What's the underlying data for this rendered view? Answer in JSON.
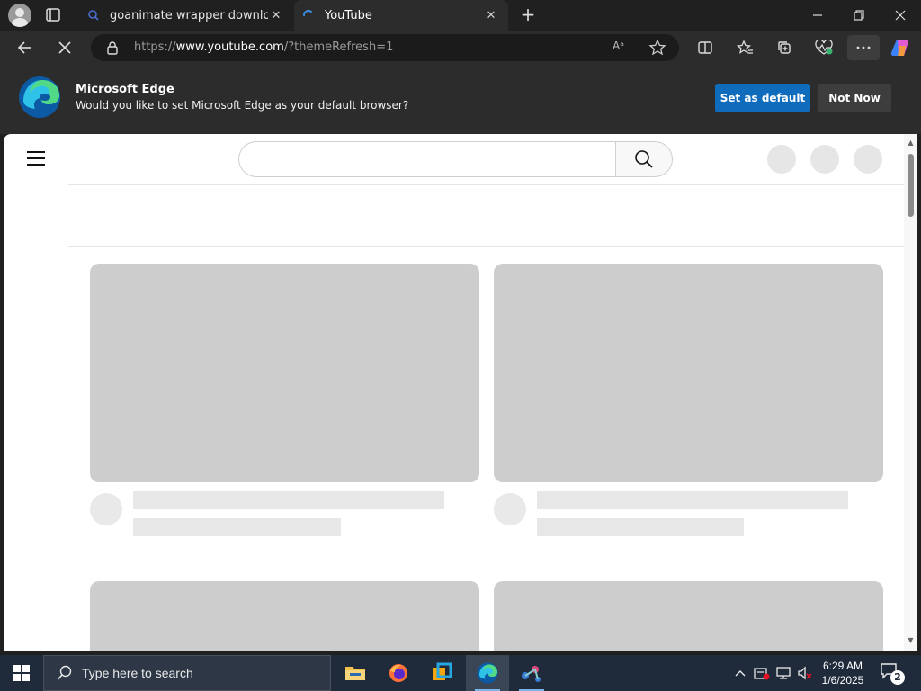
{
  "browser": {
    "tabs": [
      {
        "title": "goanimate wrapper download - S",
        "active": false
      },
      {
        "title": "YouTube",
        "active": true
      }
    ],
    "url_prefix": "https://",
    "url_host": "www.youtube.com",
    "url_path": "/?themeRefresh=1",
    "read_aloud_label": "Aᵃ",
    "new_tab_symbol": "+"
  },
  "infobar": {
    "title": "Microsoft Edge",
    "message": "Would you like to set Microsoft Edge as your default browser?",
    "set_default_label": "Set as default",
    "not_now_label": "Not Now"
  },
  "youtube": {
    "search_value": "",
    "state": "loading skeleton"
  },
  "taskbar": {
    "search_placeholder": "Type here to search",
    "time": "6:29 AM",
    "date": "1/6/2025",
    "notification_count": "2"
  },
  "colors": {
    "accent": "#0f6cbd",
    "chrome_dark": "#202020",
    "skeleton": "#cdcdcd"
  }
}
